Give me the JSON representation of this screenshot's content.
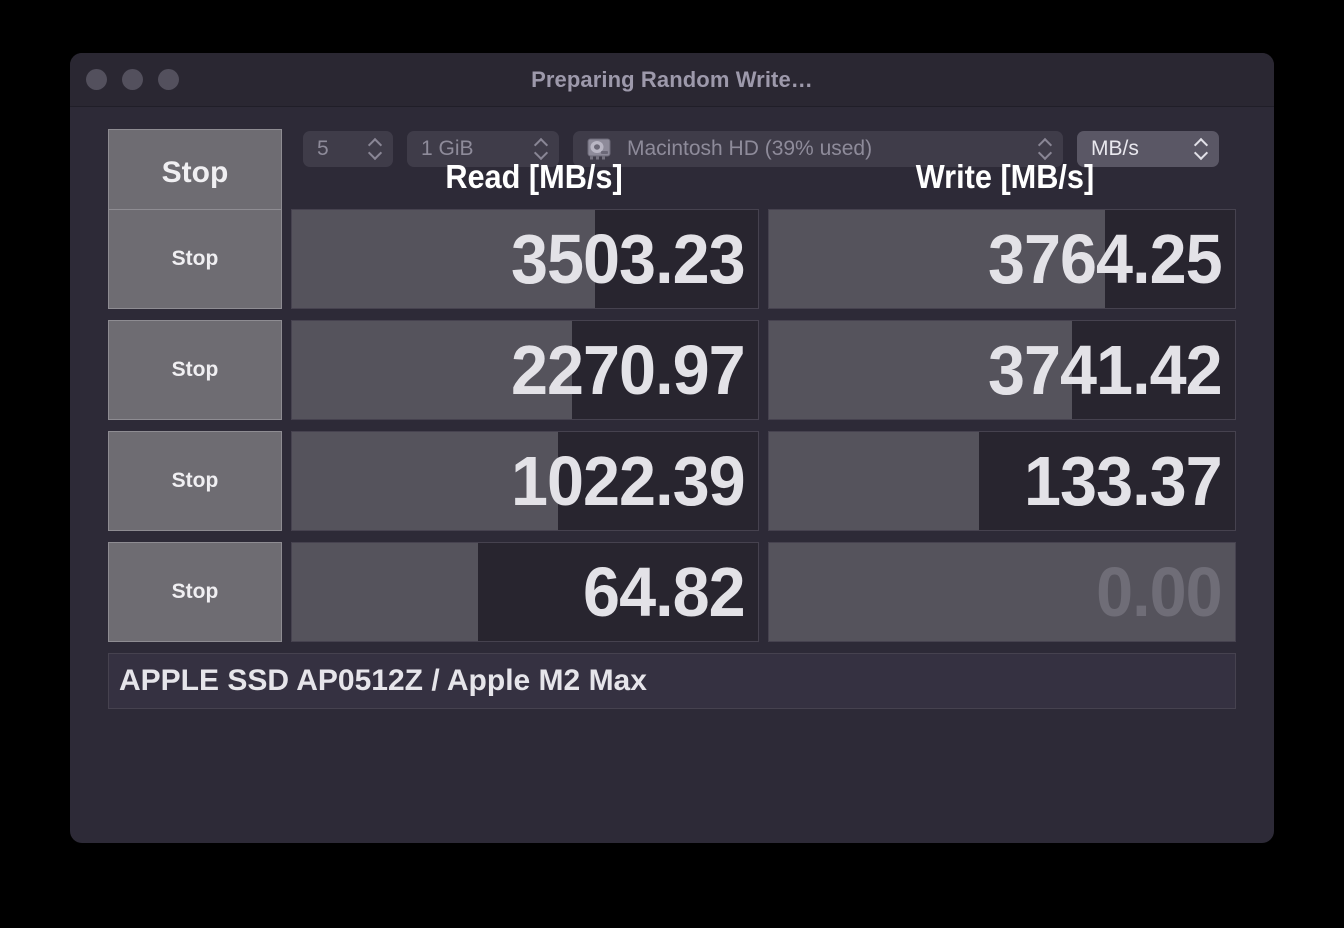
{
  "window": {
    "title": "Preparing Random Write…",
    "traffic_lights": [
      "close",
      "minimize",
      "zoom"
    ]
  },
  "toolbar": {
    "stop_label": "Stop",
    "runs": {
      "value": "5",
      "icon": "stepper-chevrons-icon"
    },
    "size": {
      "value": "1 GiB",
      "icon": "stepper-chevrons-icon"
    },
    "drive": {
      "value": "Macintosh HD (39% used)",
      "icon": "hard-drive-icon"
    },
    "units": {
      "value": "MB/s",
      "icon": "stepper-chevrons-icon"
    }
  },
  "table": {
    "columns": [
      "Read [MB/s]",
      "Write [MB/s]"
    ],
    "row_stop_label": "Stop",
    "rows": [
      {
        "read": "3503.23",
        "read_fill": 65,
        "write": "3764.25",
        "write_fill": 72,
        "read_pending": false,
        "write_pending": false
      },
      {
        "read": "2270.97",
        "read_fill": 60,
        "write": "3741.42",
        "write_fill": 65,
        "read_pending": false,
        "write_pending": false
      },
      {
        "read": "1022.39",
        "read_fill": 57,
        "write": "133.37",
        "write_fill": 45,
        "read_pending": false,
        "write_pending": false
      },
      {
        "read": "64.82",
        "read_fill": 40,
        "write": "0.00",
        "write_fill": 100,
        "read_pending": false,
        "write_pending": true
      }
    ]
  },
  "status": {
    "text": "APPLE SSD AP0512Z / Apple M2 Max"
  },
  "colors": {
    "window_background": "#2d2a37",
    "titlebar": "#2a2732",
    "title_text": "#9d99ab",
    "cell_background": "#28252f",
    "bar_fill": "#55535c",
    "button_fill": "#6e6c72",
    "value_text": "#e3e2e7",
    "pending_text": "#6f6d77",
    "status_background": "#353141"
  }
}
